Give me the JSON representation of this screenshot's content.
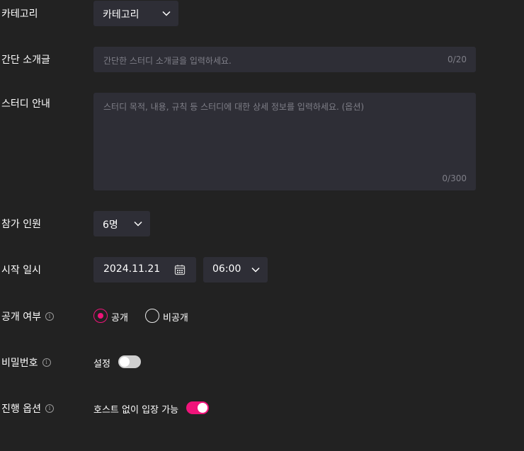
{
  "category": {
    "label": "카테고리",
    "selected": "카테고리"
  },
  "intro": {
    "label": "간단 소개글",
    "placeholder": "간단한 스터디 소개글을 입력하세요.",
    "counter": "0/20"
  },
  "guide": {
    "label": "스터디 안내",
    "placeholder": "스터디 목적, 내용, 규칙 등 스터디에 대한 상세 정보를 입력하세요. (옵션)",
    "counter": "0/300"
  },
  "participants": {
    "label": "참가 인원",
    "selected": "6명"
  },
  "start": {
    "label": "시작 일시",
    "date": "2024.11.21",
    "time": "06:00"
  },
  "visibility": {
    "label": "공개 여부",
    "options": [
      {
        "label": "공개",
        "selected": true
      },
      {
        "label": "비공개",
        "selected": false
      }
    ]
  },
  "password": {
    "label": "비밀번호",
    "toggle_label": "설정",
    "toggle_on": false
  },
  "progress_option": {
    "label": "진행 옵션",
    "toggle_label": "호스트 없이 입장 가능",
    "toggle_on": true
  },
  "colors": {
    "accent": "#f0147a",
    "input_bg": "#2e2e36",
    "page_bg": "#222222"
  },
  "icons": {
    "info": "info-icon",
    "dropdown": "chevron-down-icon",
    "calendar": "calendar-icon"
  }
}
